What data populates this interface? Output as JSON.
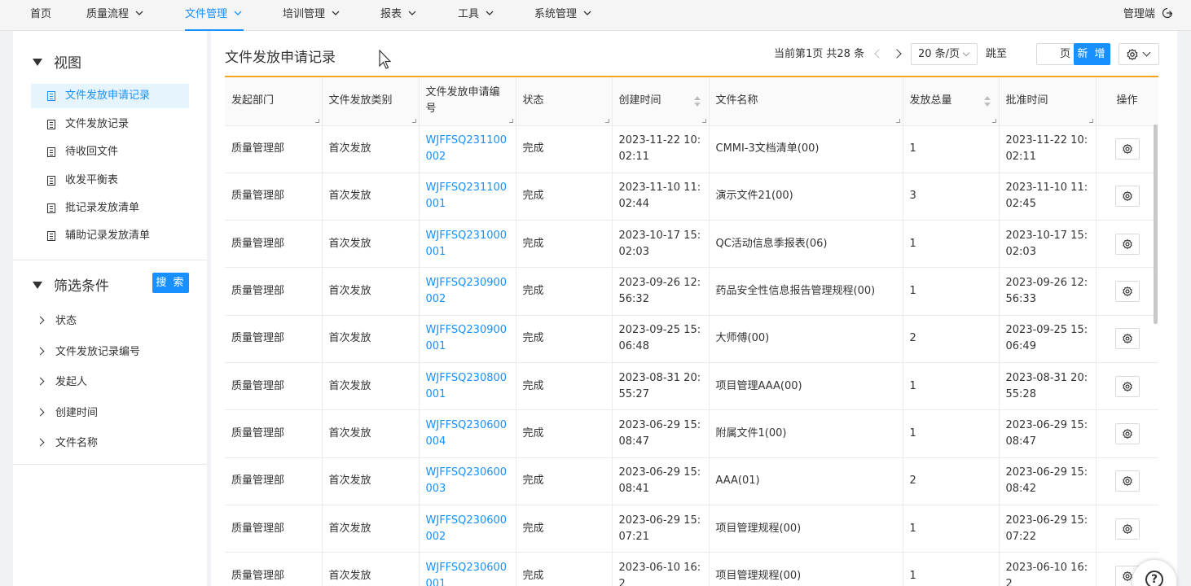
{
  "nav": {
    "items": [
      {
        "label": "首页",
        "has_chevron": false
      },
      {
        "label": "质量流程",
        "has_chevron": true
      },
      {
        "label": "文件管理",
        "has_chevron": true,
        "active": true
      },
      {
        "label": "培训管理",
        "has_chevron": true
      },
      {
        "label": "报表",
        "has_chevron": true
      },
      {
        "label": "工具",
        "has_chevron": true
      },
      {
        "label": "系统管理",
        "has_chevron": true
      }
    ],
    "right_label": "管理端",
    "right_icon": "logout-icon"
  },
  "sidebar": {
    "view_title": "视图",
    "view_items": [
      {
        "label": "文件发放申请记录",
        "active": true
      },
      {
        "label": "文件发放记录"
      },
      {
        "label": "待收回文件"
      },
      {
        "label": "收发平衡表"
      },
      {
        "label": "批记录发放清单"
      },
      {
        "label": "辅助记录发放清单"
      }
    ],
    "filter_title": "筛选条件",
    "search_label": "搜 索",
    "filters": [
      "状态",
      "文件发放记录编号",
      "发起人",
      "创建时间",
      "文件名称"
    ]
  },
  "main": {
    "title": "文件发放申请记录",
    "pager": {
      "info": "当前第1页 共28 条",
      "page_size": "20 条/页",
      "jump_label": "跳至",
      "page_unit": "页",
      "jump_value": ""
    },
    "add_label": "新 增",
    "accent_color": "#1890ff",
    "table_top_border_color": "#f5a623"
  },
  "table": {
    "columns": [
      "发起部门",
      "文件发放类别",
      "文件发放申请编号",
      "状态",
      "创建时间",
      "文件名称",
      "发放总量",
      "批准时间",
      "操作"
    ],
    "rows": [
      {
        "dept": "质量管理部",
        "type": "首次发放",
        "code": "WJFFSQ231100002",
        "status": "完成",
        "created": "2023-11-22 10:02:11",
        "file": "CMMI-3文档清单(00)",
        "qty": "1",
        "approved": "2023-11-22 10:02:11"
      },
      {
        "dept": "质量管理部",
        "type": "首次发放",
        "code": "WJFFSQ231100001",
        "status": "完成",
        "created": "2023-11-10 11:02:44",
        "file": "演示文件21(00)",
        "qty": "3",
        "approved": "2023-11-10 11:02:45"
      },
      {
        "dept": "质量管理部",
        "type": "首次发放",
        "code": "WJFFSQ231000001",
        "status": "完成",
        "created": "2023-10-17 15:02:03",
        "file": "QC活动信息季报表(06)",
        "qty": "1",
        "approved": "2023-10-17 15:02:03"
      },
      {
        "dept": "质量管理部",
        "type": "首次发放",
        "code": "WJFFSQ230900002",
        "status": "完成",
        "created": "2023-09-26 12:56:32",
        "file": "药品安全性信息报告管理规程(00)",
        "qty": "1",
        "approved": "2023-09-26 12:56:33"
      },
      {
        "dept": "质量管理部",
        "type": "首次发放",
        "code": "WJFFSQ230900001",
        "status": "完成",
        "created": "2023-09-25 15:06:48",
        "file": "大师傅(00)",
        "qty": "2",
        "approved": "2023-09-25 15:06:49"
      },
      {
        "dept": "质量管理部",
        "type": "首次发放",
        "code": "WJFFSQ230800001",
        "status": "完成",
        "created": "2023-08-31 20:55:27",
        "file": "项目管理AAA(00)",
        "qty": "1",
        "approved": "2023-08-31 20:55:28"
      },
      {
        "dept": "质量管理部",
        "type": "首次发放",
        "code": "WJFFSQ230600004",
        "status": "完成",
        "created": "2023-06-29 15:08:47",
        "file": "附属文件1(00)",
        "qty": "1",
        "approved": "2023-06-29 15:08:47"
      },
      {
        "dept": "质量管理部",
        "type": "首次发放",
        "code": "WJFFSQ230600003",
        "status": "完成",
        "created": "2023-06-29 15:08:41",
        "file": "AAA(01)",
        "qty": "2",
        "approved": "2023-06-29 15:08:42"
      },
      {
        "dept": "质量管理部",
        "type": "首次发放",
        "code": "WJFFSQ230600002",
        "status": "完成",
        "created": "2023-06-29 15:07:21",
        "file": "项目管理规程(00)",
        "qty": "1",
        "approved": "2023-06-29 15:07:22"
      },
      {
        "dept": "质量管理部",
        "type": "首次发放",
        "code": "WJFFSQ230600001",
        "status": "完成",
        "created": "2023-06-10 16:2",
        "file": "项目管理规程(00)",
        "qty": "1",
        "approved": "2023-06-10 16:2"
      }
    ]
  },
  "help": {
    "label": "?"
  }
}
